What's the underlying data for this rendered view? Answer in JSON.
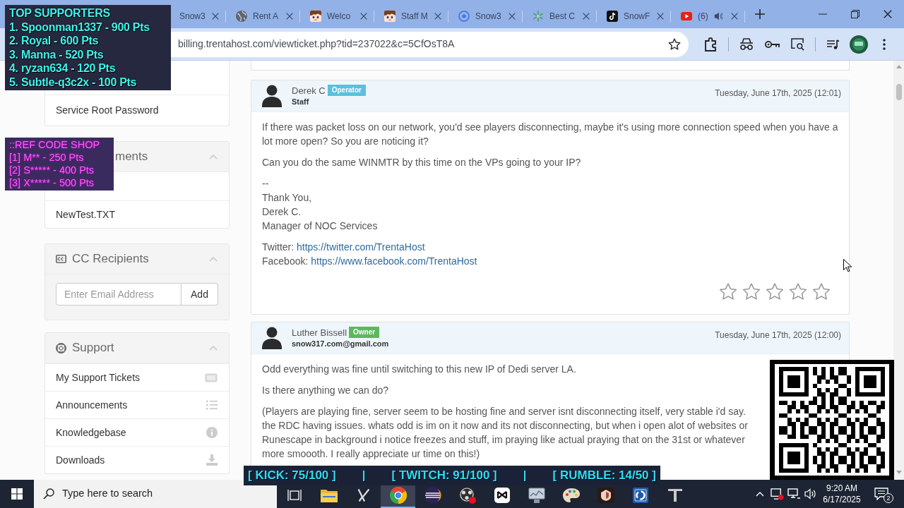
{
  "browser": {
    "tabs": [
      {
        "title": "Snow3",
        "selected": false,
        "audio": false
      },
      {
        "title": "Rent A",
        "selected": false,
        "audio": false
      },
      {
        "title": "Welco",
        "selected": false,
        "audio": false
      },
      {
        "title": "Staff M",
        "selected": false,
        "audio": false
      },
      {
        "title": "Snow3",
        "selected": false,
        "audio": false
      },
      {
        "title": "Best C",
        "selected": false,
        "audio": false
      },
      {
        "title": "SnowF",
        "selected": false,
        "audio": false
      },
      {
        "title": "(6)",
        "selected": false,
        "audio": true
      }
    ],
    "url": "billing.trentahost.com/viewticket.php?tid=237022&c=5CfOsT8A"
  },
  "sidebar": {
    "panels": [
      {
        "kind": "list",
        "items": [
          {
            "label": "Service Root Password"
          }
        ]
      },
      {
        "kind": "list",
        "title": "ments",
        "expanded": true,
        "items": [
          {
            "label": "NewTest.TXT"
          }
        ]
      },
      {
        "kind": "form",
        "title": "CC Recipients",
        "expanded": true,
        "email_field": {
          "placeholder": "Enter Email Address"
        },
        "button": "Add"
      },
      {
        "kind": "list",
        "title": "Support",
        "expanded": true,
        "items": [
          {
            "label": "My Support Tickets"
          },
          {
            "label": "Announcements"
          },
          {
            "label": "Knowledgebase"
          },
          {
            "label": "Downloads"
          }
        ]
      }
    ]
  },
  "replies": [
    {
      "author": "Derek C",
      "badge": {
        "text": "Operator",
        "color": "#5bc0de"
      },
      "subtitle": "Staff",
      "date": "Tuesday, June 17th, 2025 (12:01)",
      "paragraphs": [
        {
          "kind": "text",
          "lines": [
            "If there was packet loss on our network, you'd see players disconnecting, maybe it's using more connection speed when you have a lot more open? So you are noticing it?"
          ]
        },
        {
          "kind": "text",
          "lines": [
            "Can you do the same WINMTR by this time on the VPs going to your IP?"
          ]
        },
        {
          "kind": "text",
          "lines": [
            "--",
            "Thank You,",
            "Derek C.",
            "Manager of NOC Services"
          ]
        },
        {
          "kind": "links",
          "lines": [
            {
              "label": "Twitter:",
              "url": "https://twitter.com/TrentaHost"
            },
            {
              "label": "Facebook:",
              "url": "https://www.facebook.com/TrentaHost"
            }
          ]
        }
      ],
      "stars": 0
    },
    {
      "author": "Luther Bissell",
      "badge": {
        "text": "Owner",
        "color": "#5cb85c"
      },
      "subtitle": "snow317.com@gmail.com",
      "date": "Tuesday, June 17th, 2025 (12:00)",
      "paragraphs": [
        {
          "kind": "text",
          "lines": [
            "Odd everything was fine until switching to this new IP of Dedi server LA."
          ]
        },
        {
          "kind": "text",
          "lines": [
            "Is there anything we can do?"
          ]
        },
        {
          "kind": "text",
          "lines": [
            "(Players are playing fine, server seem to be hosting fine and server isnt disconnecting itself, very stable i'd say.",
            "the RDC having issues. whats odd is im on it now and its not disconnecting, but when i open alot of websites or",
            "Runescape in background i notice freezes and stuff, im praying like actual praying that on the 31st or whatever",
            "more smoooth. I really appreciate ur time on this!)"
          ]
        }
      ]
    }
  ],
  "stream_overlay": {
    "top_supporters": {
      "title": "TOP SUPPORTERS",
      "entries": [
        "1. Spoonman1337 - 900 Pts",
        "2. Royal - 600 Pts",
        "3. Manna - 520 Pts",
        "4. ryzan634 - 120 Pts",
        "5. Subtle-q3c2x - 100 Pts"
      ]
    },
    "ref_code_shop": {
      "title": "::REF CODE SHOP",
      "entries": [
        "[1] M** - 250 Pts",
        "[2] S***** - 400 Pts",
        "[3] X***** - 500 Pts"
      ]
    },
    "goals": [
      "[ KICK: 75/100 ]",
      "|",
      "[ TWITCH: 91/100 ]",
      "|",
      "[ RUMBLE: 14/50 ]"
    ]
  },
  "taskbar": {
    "search": {
      "placeholder": "Type here to search"
    },
    "apps": [
      {
        "selected": false
      },
      {
        "selected": false
      },
      {
        "selected": true
      },
      {
        "selected": false
      },
      {
        "selected": false
      },
      {
        "selected": false
      },
      {
        "selected": false
      },
      {
        "selected": false
      },
      {
        "selected": false
      },
      {
        "selected": false
      },
      {
        "selected": false
      }
    ],
    "time": "9:20 AM",
    "date": "6/17/2025",
    "notification_count": "2"
  }
}
